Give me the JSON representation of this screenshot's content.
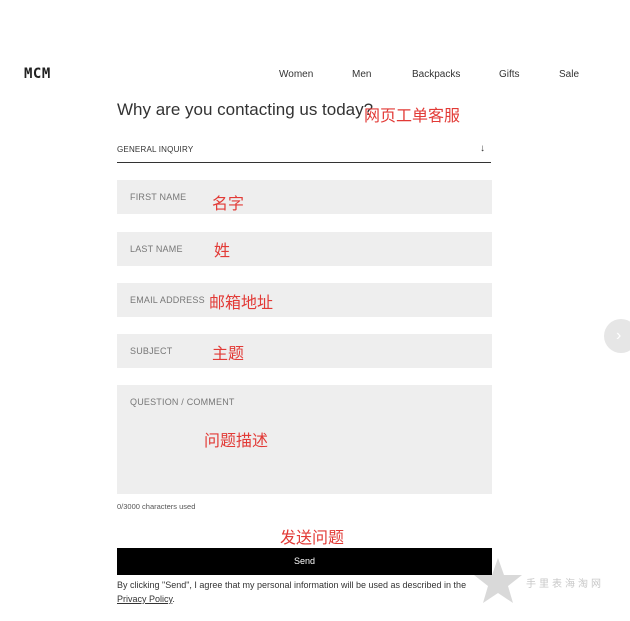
{
  "header": {
    "logo": "MCM",
    "nav": [
      "Women",
      "Men",
      "Backpacks",
      "Gifts",
      "Sale"
    ]
  },
  "form": {
    "heading": "Why are you contacting us today?",
    "heading_note": "网页工单客服",
    "reason_select": {
      "value": "GENERAL INQUIRY",
      "arrow": "↓"
    },
    "first_name": {
      "placeholder": "FIRST NAME",
      "note": "名字"
    },
    "last_name": {
      "placeholder": "LAST NAME",
      "note": "姓"
    },
    "email": {
      "placeholder": "EMAIL ADDRESS",
      "note": "邮箱地址"
    },
    "subject": {
      "placeholder": "SUBJECT",
      "note": "主题"
    },
    "question": {
      "placeholder": "QUESTION / COMMENT",
      "note": "问题描述"
    },
    "counter": "0/3000 characters used",
    "send_note": "发送问题",
    "send_label": "Send",
    "consent_text": "By clicking \"Send\", I agree that my personal information will be used as described in the",
    "privacy_link": "Privacy Policy",
    "consent_end": "."
  },
  "watermark": {
    "text": "手里表海淘网"
  },
  "icons": {
    "next_slide": "chevron-right-icon",
    "watermark_star": "star-icon"
  },
  "colors": {
    "annotation": "#e23a36",
    "field_bg": "#eeeeee",
    "button_bg": "#000000"
  }
}
